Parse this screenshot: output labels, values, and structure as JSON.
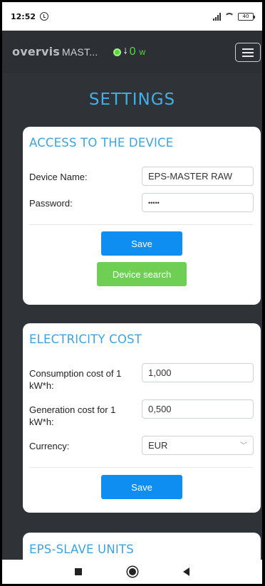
{
  "status_bar": {
    "time": "12:52",
    "battery": "40"
  },
  "header": {
    "brand": "overvis",
    "device": "MAST...",
    "power_value": "0",
    "power_unit": "w",
    "status_color": "#59d63c"
  },
  "page": {
    "title": "SETTINGS"
  },
  "access_card": {
    "title": "ACCESS TO THE DEVICE",
    "device_name_label": "Device Name:",
    "device_name_value": "EPS-MASTER RAW",
    "password_label": "Password:",
    "password_value": "•••••",
    "save_label": "Save",
    "search_label": "Device search"
  },
  "electricity_card": {
    "title": "ELECTRICITY COST",
    "consumption_label": "Consumption cost of 1 kW*h:",
    "consumption_value": "1,000",
    "generation_label": "Generation cost for 1 kW*h:",
    "generation_value": "0,500",
    "currency_label": "Currency:",
    "currency_value": "EUR",
    "save_label": "Save"
  },
  "slave_card": {
    "title": "EPS-SLAVE UNITS"
  },
  "colors": {
    "accent": "#3fb0ea",
    "save_button": "#0f8ef2",
    "search_button": "#6fcf55",
    "background": "#2f3237"
  }
}
